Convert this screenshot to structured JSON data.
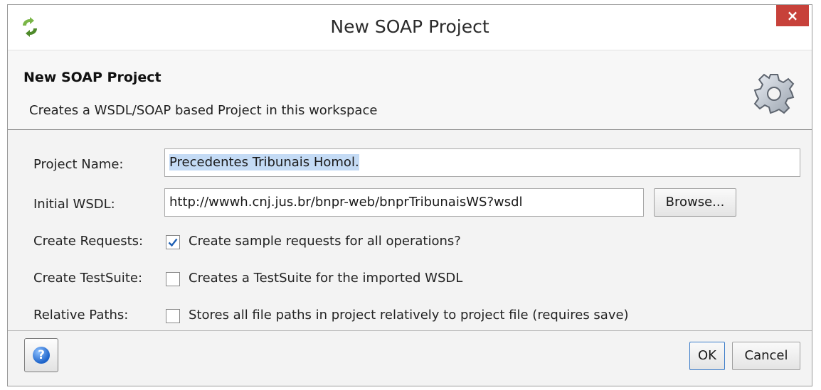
{
  "window": {
    "title": "New SOAP Project",
    "close_glyph": "×"
  },
  "header": {
    "title": "New SOAP Project",
    "description": "Creates a WSDL/SOAP based Project in this workspace",
    "icon": "gear-icon"
  },
  "form": {
    "project_name": {
      "label": "Project Name:",
      "value": "Precedentes Tribunais Homol.",
      "selected": true
    },
    "initial_wsdl": {
      "label": "Initial WSDL:",
      "value": "http://wwwh.cnj.jus.br/bnpr-web/bnprTribunaisWS?wsdl",
      "browse_label": "Browse..."
    },
    "create_requests": {
      "label": "Create Requests:",
      "checkbox_label": "Create sample requests for all operations?",
      "checked": true
    },
    "create_testsuite": {
      "label": "Create TestSuite:",
      "checkbox_label": "Creates a TestSuite for the imported WSDL",
      "checked": false
    },
    "relative_paths": {
      "label": "Relative Paths:",
      "checkbox_label": "Stores all file paths in project relatively to project file (requires save)",
      "checked": false
    }
  },
  "footer": {
    "help_glyph": "?",
    "ok_label": "OK",
    "cancel_label": "Cancel"
  },
  "colors": {
    "close_button": "#c7413a",
    "selection": "#c4dbf5",
    "checkmark": "#1e5fb4"
  }
}
